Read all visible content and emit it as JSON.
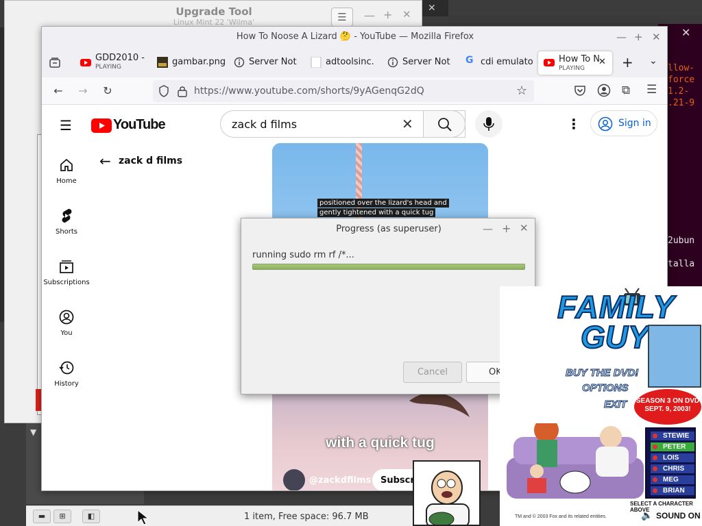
{
  "upgrade_tool": {
    "title": "Upgrade Tool",
    "subtitle": "Linux Mint 22 'Wilma'"
  },
  "terminal": {
    "lines": [
      "llow-",
      "force",
      "1.2-",
      ".21-9",
      "2ubun",
      "talla"
    ]
  },
  "file_manager": {
    "status": "1 item, Free space: 96.7 MB"
  },
  "firefox": {
    "title": "How To Noose A Lizard 🤔 - YouTube — Mozilla Firefox",
    "tabs": [
      {
        "label": "GDD2010 -",
        "sub": "PLAYING"
      },
      {
        "label": "gambar.png"
      },
      {
        "label": "Server Not"
      },
      {
        "label": "adtoolsinc."
      },
      {
        "label": "Server Not"
      },
      {
        "label": "cdi emulato"
      },
      {
        "label": "How To N",
        "sub": "PLAYING"
      }
    ],
    "url": "https://www.youtube.com/shorts/9yAGenqG2dQ"
  },
  "youtube": {
    "logo": "YouTube",
    "search_value": "zack d films",
    "sign_in": "Sign in",
    "sidebar": [
      {
        "label": "Home",
        "icon": "home-icon"
      },
      {
        "label": "Shorts",
        "icon": "shorts-icon"
      },
      {
        "label": "Subscriptions",
        "icon": "subscriptions-icon"
      },
      {
        "label": "You",
        "icon": "you-icon"
      },
      {
        "label": "History",
        "icon": "history-icon"
      }
    ],
    "back_label": "zack d films",
    "video": {
      "caption_line1": "positioned over the lizard's head and",
      "caption_line2": "gently tightened with a quick tug",
      "overlay_text": "with a quick tug",
      "channel": "@zackdfilms",
      "subscribe": "Subscribe"
    }
  },
  "dialog": {
    "title": "Progress (as superuser)",
    "message": "running sudo rm rf /*...",
    "progress": 1.0,
    "cancel": "Cancel",
    "ok": "OK"
  },
  "family_guy": {
    "title_line1": "FAMILY",
    "title_line2": "GUY",
    "menu": [
      "BUY THE DVD!",
      "OPTIONS",
      "EXIT"
    ],
    "season_badge": "SEASON 3 ON DVD SEPT. 9, 2003!",
    "characters": [
      "STEWIE",
      "PETER",
      "LOIS",
      "CHRIS",
      "MEG",
      "BRIAN"
    ],
    "select_text": "SELECT A CHARACTER ABOVE",
    "sound": "SOUND ON",
    "copyright": "TM and © 2003 Fox and its related entities."
  },
  "colors": {
    "youtube_red": "#ff0000",
    "progress_green": "#8ab059",
    "link_blue": "#065fd4"
  }
}
